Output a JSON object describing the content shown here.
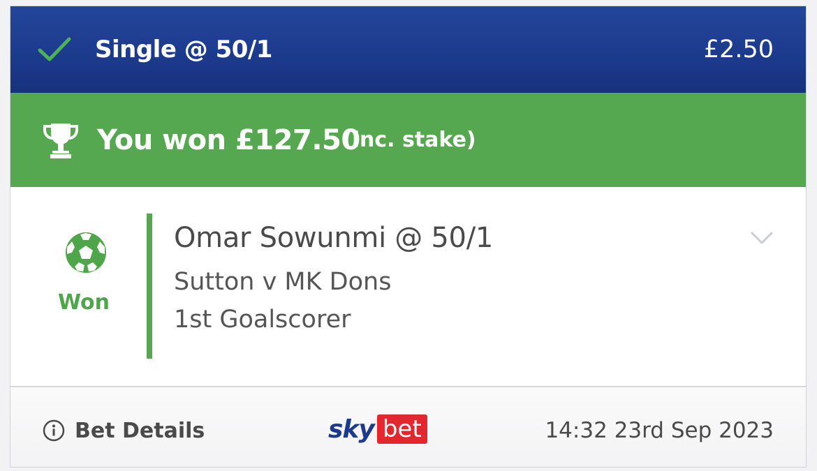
{
  "header": {
    "bet_type": "Single @ 50/1",
    "stake": "£2.50",
    "check_icon": "check-icon"
  },
  "winnings": {
    "amount_text": "You won £127.50",
    "note": "(inc. stake)",
    "trophy_icon": "trophy-icon"
  },
  "selection": {
    "status": "Won",
    "name": "Omar Sowunmi @ 50/1",
    "event": "Sutton v MK Dons",
    "market": "1st Goalscorer",
    "sport_icon": "football-icon",
    "expand_icon": "chevron-down-icon"
  },
  "footer": {
    "details_label": "Bet Details",
    "logo_sky": "sky",
    "logo_bet": "bet",
    "placed_time": "14:32 23rd Sep 2023"
  },
  "colors": {
    "header_blue": "#1c3a8c",
    "win_green": "#55a84f",
    "logo_red": "#e3272c"
  }
}
